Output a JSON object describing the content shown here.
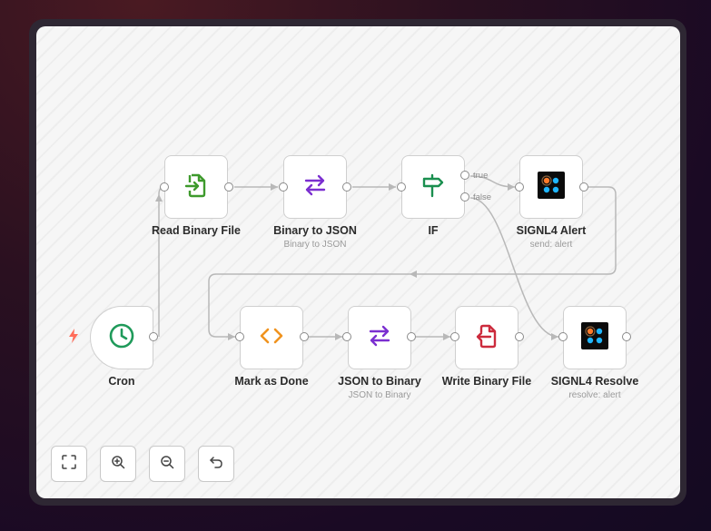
{
  "nodes": {
    "read_binary": {
      "label": "Read Binary File",
      "icon": "file-import-icon",
      "color": "#3e9a2c"
    },
    "binary_to_json": {
      "label": "Binary to JSON",
      "subtitle": "Binary to JSON",
      "icon": "arrows-exchange-icon",
      "color": "#7b2fd0"
    },
    "if": {
      "label": "IF",
      "icon": "signpost-icon",
      "color": "#1a8f4f"
    },
    "signl4_alert": {
      "label": "SIGNL4 Alert",
      "subtitle": "send: alert",
      "icon": "signl4-logo-icon"
    },
    "cron": {
      "label": "Cron",
      "icon": "clock-icon",
      "color": "#1f9a5a"
    },
    "mark_done": {
      "label": "Mark as Done",
      "icon": "code-brackets-icon",
      "color": "#f0931f"
    },
    "json_to_binary": {
      "label": "JSON to Binary",
      "subtitle": "JSON to Binary",
      "icon": "arrows-exchange-icon",
      "color": "#7b2fd0"
    },
    "write_binary": {
      "label": "Write Binary File",
      "icon": "file-export-icon",
      "color": "#cc2b3d"
    },
    "signl4_resolve": {
      "label": "SIGNL4 Resolve",
      "subtitle": "resolve: alert",
      "icon": "signl4-logo-icon"
    }
  },
  "branches": {
    "true_label": "true",
    "false_label": "false"
  },
  "controls": [
    {
      "name": "fit-view-button",
      "icon": "fullscreen-icon"
    },
    {
      "name": "zoom-in-button",
      "icon": "zoom-in-icon"
    },
    {
      "name": "zoom-out-button",
      "icon": "zoom-out-icon"
    },
    {
      "name": "reset-zoom-button",
      "icon": "undo-icon"
    }
  ],
  "colors": {
    "wire": "#b8b8b8",
    "trigger_bolt": "#ff6d5a"
  }
}
